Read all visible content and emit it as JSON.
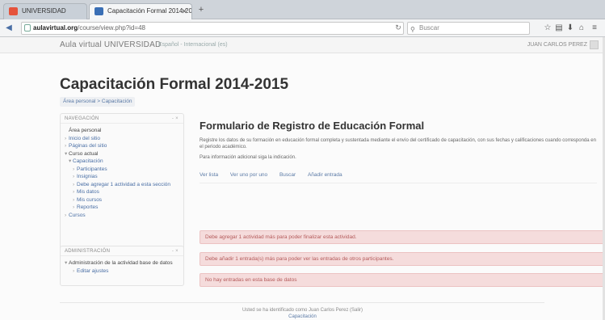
{
  "browser": {
    "tabs": [
      {
        "label": "UNIVERSIDAD"
      },
      {
        "label": "Capacitación Formal 2014-2015"
      }
    ],
    "new_tab": "+",
    "url_host": "aulavirtual.org",
    "url_path": "/course/view.php?id=48",
    "reload": "↻",
    "search_placeholder": "Buscar",
    "icons": [
      "star-icon",
      "reader-icon",
      "download-icon",
      "home-icon",
      "menu-icon"
    ]
  },
  "site": {
    "brand": "Aula virtual UNIVERSIDAD",
    "top_menu": "Español - Internacional (es)",
    "user_name": "JUAN CARLOS PEREZ"
  },
  "page": {
    "title": "Capacitación Formal 2014-2015",
    "breadcrumb": "Área personal > Capacitación"
  },
  "sidebar": {
    "nav_heading": "NAVEGACIÓN",
    "collapse": "- ×",
    "items": [
      {
        "label": "Área personal",
        "bullet": "",
        "dark": true
      },
      {
        "label": "Inicio del sitio",
        "bullet": "›",
        "dark": false
      },
      {
        "label": "Páginas del sitio",
        "bullet": "›",
        "dark": false
      },
      {
        "label": "Curso actual",
        "bullet": "▾",
        "dark": true
      },
      {
        "label": "Capacitación",
        "bullet": "▾",
        "dark": false
      },
      {
        "label": "Participantes",
        "bullet": "›",
        "dark": false
      },
      {
        "label": "Insignias",
        "bullet": "›",
        "dark": false
      },
      {
        "label": "Debe agregar 1 actividad a esta sección",
        "bullet": "›",
        "dark": false
      },
      {
        "label": "Mis datos",
        "bullet": "›",
        "dark": false
      },
      {
        "label": "Mis cursos",
        "bullet": "›",
        "dark": false
      },
      {
        "label": "Reportes",
        "bullet": "›",
        "dark": false
      },
      {
        "label": "Cursos",
        "bullet": "›",
        "dark": false
      }
    ],
    "admin_heading": "ADMINISTRACIÓN",
    "admin_items": [
      {
        "label": "Administración de la actividad base de datos",
        "bullet": "▾"
      },
      {
        "label": "Editar ajustes",
        "bullet": "›"
      }
    ]
  },
  "main": {
    "title": "Formulario de Registro de Educación Formal",
    "intro": "Registre los datos de su formación en educación formal completa y sustentada mediante el envío del certificado de capacitación, con sus fechas y calificaciones cuando corresponda en el periodo académico.",
    "intro2": "Para información adicional siga la indicación.",
    "tabs": [
      "Ver lista",
      "Ver uno por uno",
      "Buscar",
      "Añadir entrada"
    ],
    "alerts": [
      "Debe agregar 1 actividad más para poder finalizar esta actividad.",
      "Debe añadir 1 entrada(s) más para poder ver las entradas de otros participantes.",
      "No hay entradas en esta base de datos"
    ]
  },
  "footer": {
    "line1": "Usted se ha identificado como Juan Carlos Perez (Salir)",
    "line2": "Capacitación"
  }
}
